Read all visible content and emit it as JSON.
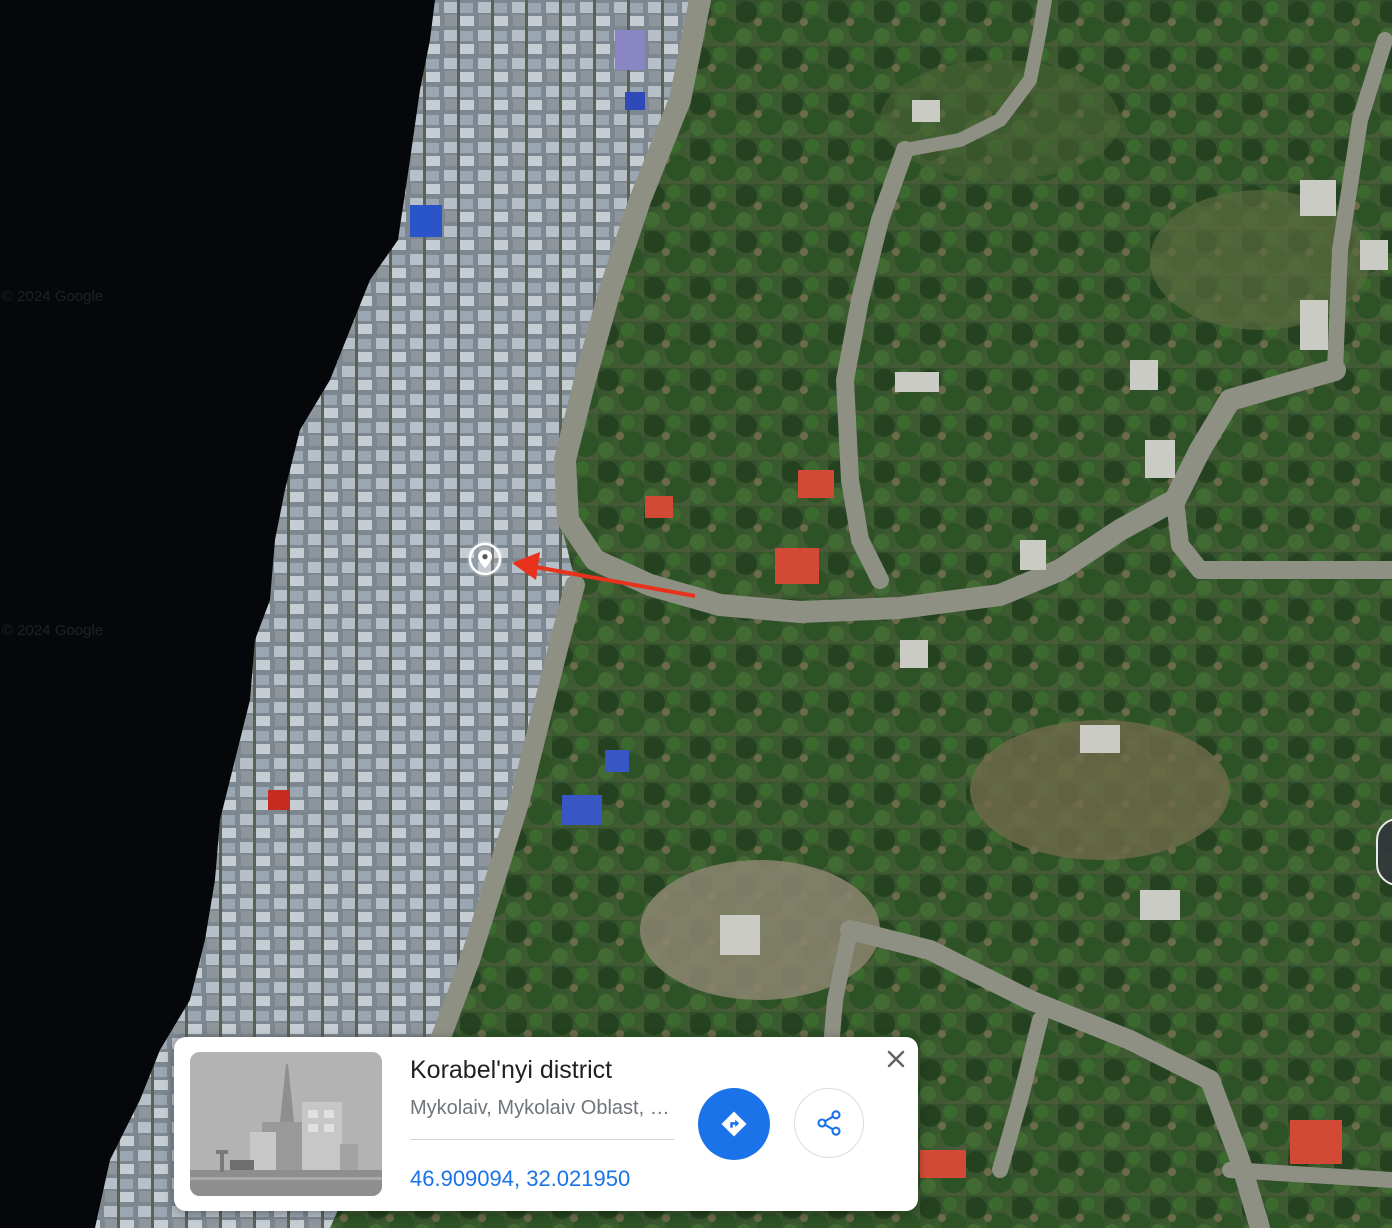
{
  "map": {
    "type": "satellite",
    "watermark_text": "© 2024 Google",
    "marker_icon": "map-pin-icon",
    "annotation_arrow_color": "#e8321c"
  },
  "place_card": {
    "title": "Korabel'nyi district",
    "subtitle": "Mykolaiv, Mykolaiv Oblast, Ukraine",
    "coordinates": "46.909094, 32.021950",
    "thumbnail_icon": "city-placeholder-icon",
    "directions_icon": "directions-icon",
    "share_icon": "share-icon",
    "close_icon": "close-icon",
    "accent_color": "#1a73e8"
  }
}
